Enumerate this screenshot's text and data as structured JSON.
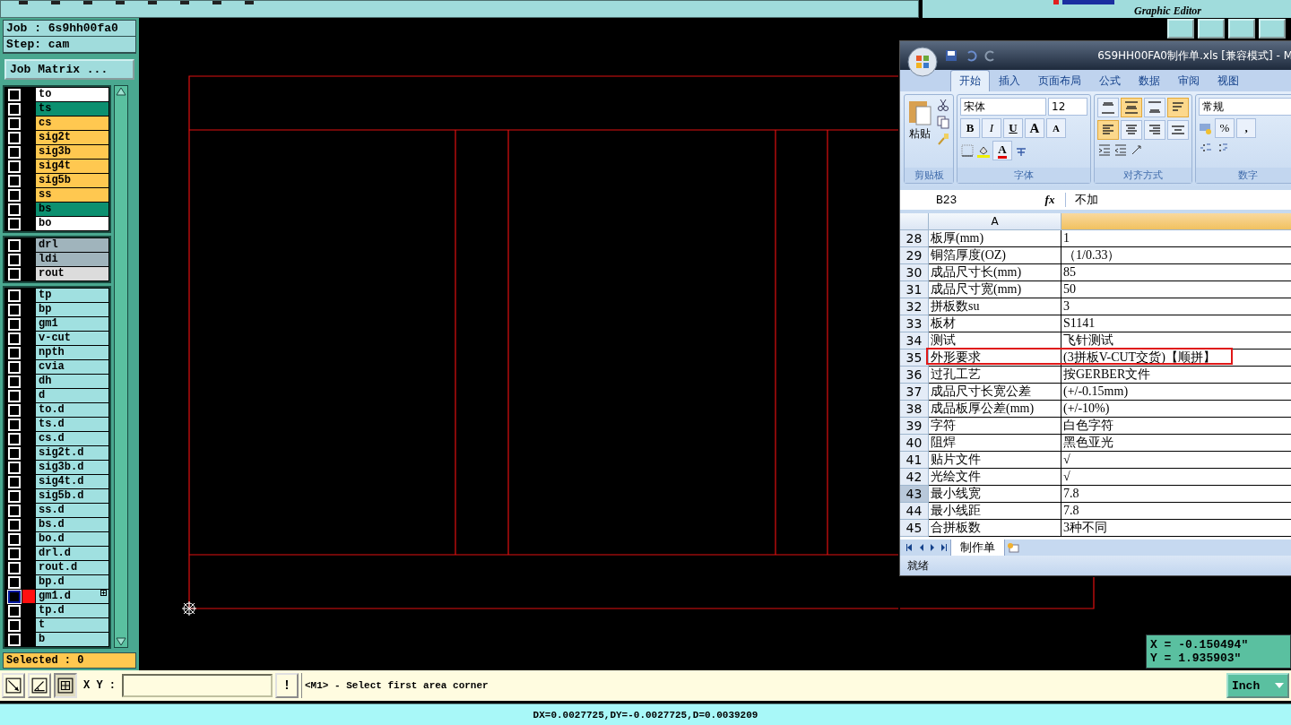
{
  "top_bar": {
    "subtitle": "Graphic Editor"
  },
  "job": {
    "job": "Job : 6s9hh00fa0",
    "step": "Step: cam",
    "matrix_button": "Job Matrix ..."
  },
  "layer_groups": [
    {
      "layers": [
        {
          "name": "to",
          "color": "#ffffff",
          "selected": false
        },
        {
          "name": "ts",
          "color": "#0c9070",
          "selected": false
        },
        {
          "name": "cs",
          "color": "#ffc850",
          "selected": false
        },
        {
          "name": "sig2t",
          "color": "#ffc850",
          "selected": false
        },
        {
          "name": "sig3b",
          "color": "#ffc850",
          "selected": false
        },
        {
          "name": "sig4t",
          "color": "#ffc850",
          "selected": false
        },
        {
          "name": "sig5b",
          "color": "#ffc850",
          "selected": false
        },
        {
          "name": "ss",
          "color": "#ffc850",
          "selected": false
        },
        {
          "name": "bs",
          "color": "#0c9070",
          "selected": false
        },
        {
          "name": "bo",
          "color": "#ffffff",
          "selected": false
        }
      ]
    },
    {
      "layers": [
        {
          "name": "drl",
          "color": "#a0b4bc",
          "selected": false
        },
        {
          "name": "ldi",
          "color": "#a0b4bc",
          "selected": false
        },
        {
          "name": "rout",
          "color": "#dcdcdc",
          "selected": false
        }
      ]
    },
    {
      "layers": [
        {
          "name": "tp",
          "color": "#a0e0e0",
          "selected": false
        },
        {
          "name": "bp",
          "color": "#a0e0e0",
          "selected": false
        },
        {
          "name": "gm1",
          "color": "#a0e0e0",
          "selected": false
        },
        {
          "name": "v-cut",
          "color": "#a0e0e0",
          "selected": false
        },
        {
          "name": "npth",
          "color": "#a0e0e0",
          "selected": false
        },
        {
          "name": "cvia",
          "color": "#a0e0e0",
          "selected": false
        },
        {
          "name": "dh",
          "color": "#a0e0e0",
          "selected": false
        },
        {
          "name": "d",
          "color": "#a0e0e0",
          "selected": false
        },
        {
          "name": "to.d",
          "color": "#a0e0e0",
          "selected": false
        },
        {
          "name": "ts.d",
          "color": "#a0e0e0",
          "selected": false
        },
        {
          "name": "cs.d",
          "color": "#a0e0e0",
          "selected": false
        },
        {
          "name": "sig2t.d",
          "color": "#a0e0e0",
          "selected": false
        },
        {
          "name": "sig3b.d",
          "color": "#a0e0e0",
          "selected": false
        },
        {
          "name": "sig4t.d",
          "color": "#a0e0e0",
          "selected": false
        },
        {
          "name": "sig5b.d",
          "color": "#a0e0e0",
          "selected": false
        },
        {
          "name": "ss.d",
          "color": "#a0e0e0",
          "selected": false
        },
        {
          "name": "bs.d",
          "color": "#a0e0e0",
          "selected": false
        },
        {
          "name": "bo.d",
          "color": "#a0e0e0",
          "selected": false
        },
        {
          "name": "drl.d",
          "color": "#a0e0e0",
          "selected": false
        },
        {
          "name": "rout.d",
          "color": "#a0e0e0",
          "selected": false
        },
        {
          "name": "bp.d",
          "color": "#a0e0e0",
          "selected": false
        },
        {
          "name": "gm1.d",
          "color": "#a0e0e0",
          "selected": true
        },
        {
          "name": "tp.d",
          "color": "#a0e0e0",
          "selected": false
        },
        {
          "name": "t",
          "color": "#a0e0e0",
          "selected": false
        },
        {
          "name": "b",
          "color": "#a0e0e0",
          "selected": false
        }
      ]
    }
  ],
  "selected_count": "Selected : 0",
  "coordinates": {
    "x": "X = -0.150494\"",
    "y": "Y = 1.935903\""
  },
  "excel": {
    "title": "6S9HH00FA0制作单.xls  [兼容模式] - M",
    "tabs": [
      {
        "label": "开始",
        "selected": true
      },
      {
        "label": "插入",
        "selected": false
      },
      {
        "label": "页面布局",
        "selected": false
      },
      {
        "label": "公式",
        "selected": false
      },
      {
        "label": "数据",
        "selected": false
      },
      {
        "label": "审阅",
        "selected": false
      },
      {
        "label": "视图",
        "selected": false
      }
    ],
    "ribbon": {
      "paste": "粘贴",
      "clipboard_label": "剪贴板",
      "font_name": "宋体",
      "font_size": "12",
      "bold": "B",
      "italic": "I",
      "underline": "U",
      "grow": "A",
      "shrink": "A",
      "font_color": "A",
      "font_label": "字体",
      "align_label": "对齐方式",
      "number_format": "常规",
      "percent": "%",
      "comma": ",",
      "number_label": "数字",
      "align_buttons": [
        {
          "kind": "top",
          "selected": false
        },
        {
          "kind": "middle",
          "selected": true
        },
        {
          "kind": "bottom",
          "selected": false
        },
        {
          "kind": "wrap",
          "selected": true
        },
        {
          "kind": "left",
          "selected": true
        },
        {
          "kind": "center",
          "selected": false
        },
        {
          "kind": "right",
          "selected": false
        },
        {
          "kind": "merge",
          "selected": false
        }
      ]
    },
    "name_box": "B23",
    "fx": "fx",
    "formula": "不加",
    "column": "A",
    "rows": [
      {
        "num": "28",
        "a": "板厚(mm)",
        "b": "1",
        "selected": false,
        "highlighted": false
      },
      {
        "num": "29",
        "a": "铜箔厚度(OZ)",
        "b": "（1/0.33）",
        "selected": false,
        "highlighted": false
      },
      {
        "num": "30",
        "a": "成品尺寸长(mm)",
        "b": "85",
        "selected": false,
        "highlighted": false
      },
      {
        "num": "31",
        "a": "成品尺寸宽(mm)",
        "b": "50",
        "selected": false,
        "highlighted": false
      },
      {
        "num": "32",
        "a": "拼板数su",
        "b": "3",
        "selected": false,
        "highlighted": false
      },
      {
        "num": "33",
        "a": "板材",
        "b": "S1141",
        "selected": false,
        "highlighted": false
      },
      {
        "num": "34",
        "a": "测试",
        "b": "飞针测试",
        "selected": false,
        "highlighted": false
      },
      {
        "num": "35",
        "a": "外形要求",
        "b": "(3拼板V-CUT交货)【顺拼】",
        "selected": false,
        "highlighted": true
      },
      {
        "num": "36",
        "a": "过孔工艺",
        "b": "按GERBER文件",
        "selected": false,
        "highlighted": false
      },
      {
        "num": "37",
        "a": "成品尺寸长宽公差",
        "b": "(+/-0.15mm)",
        "selected": false,
        "highlighted": false
      },
      {
        "num": "38",
        "a": "成品板厚公差(mm)",
        "b": "(+/-10%)",
        "selected": false,
        "highlighted": false
      },
      {
        "num": "39",
        "a": "字符",
        "b": "白色字符",
        "selected": false,
        "highlighted": false
      },
      {
        "num": "40",
        "a": "阻焊",
        "b": "黑色亚光",
        "selected": false,
        "highlighted": false
      },
      {
        "num": "41",
        "a": "贴片文件",
        "b": "√",
        "selected": false,
        "highlighted": false
      },
      {
        "num": "42",
        "a": "光绘文件",
        "b": "√",
        "selected": false,
        "highlighted": false
      },
      {
        "num": "43",
        "a": "最小线宽",
        "b": "7.8",
        "selected": true,
        "highlighted": false
      },
      {
        "num": "44",
        "a": "最小线距",
        "b": "7.8",
        "selected": false,
        "highlighted": false
      },
      {
        "num": "45",
        "a": "合拼板数",
        "b": "3种不同",
        "selected": false,
        "highlighted": false
      }
    ],
    "sheet_tab": "制作单",
    "status": "就绪"
  },
  "command_bar": {
    "tools": [
      {
        "kind": "diagonal",
        "selected": false
      },
      {
        "kind": "angle",
        "selected": false
      },
      {
        "kind": "grid",
        "selected": true
      }
    ],
    "xy_label": "X Y :",
    "alert": "!",
    "prompt": "<M1> - Select first area corner",
    "units": "Inch"
  },
  "status_bar": "DX=0.0027725,DY=-0.0027725,D=0.0039209"
}
